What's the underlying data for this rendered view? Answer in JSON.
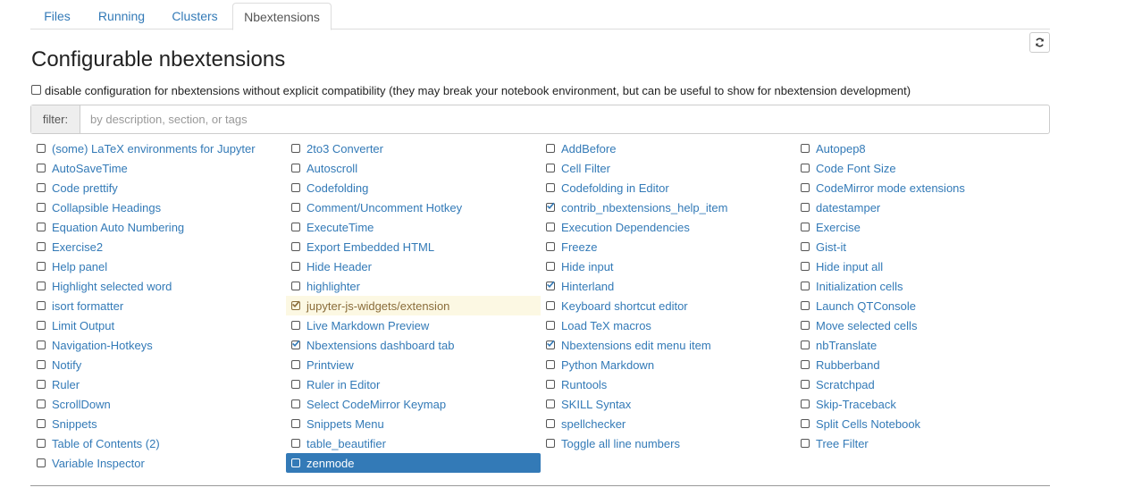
{
  "tabs": [
    {
      "label": "Files",
      "active": false
    },
    {
      "label": "Running",
      "active": false
    },
    {
      "label": "Clusters",
      "active": false
    },
    {
      "label": "Nbextensions",
      "active": true
    }
  ],
  "page_title": "Configurable nbextensions",
  "compat": {
    "label": "disable configuration for nbextensions without explicit compatibility (they may break your notebook environment, but can be useful to show for nbextension development)",
    "checked": false
  },
  "filter": {
    "label": "filter:",
    "placeholder": "by description, section, or tags",
    "value": ""
  },
  "refresh_icon": "refresh-icon",
  "colors": {
    "link": "#337ab7",
    "highlight_bg": "#fcf8e3",
    "highlight_text": "#8a6d3b",
    "selected_bg": "#337ab7"
  },
  "extensions": [
    [
      {
        "label": "(some) LaTeX environments for Jupyter",
        "checked": false
      },
      {
        "label": "AutoSaveTime",
        "checked": false
      },
      {
        "label": "Code prettify",
        "checked": false
      },
      {
        "label": "Collapsible Headings",
        "checked": false
      },
      {
        "label": "Equation Auto Numbering",
        "checked": false
      },
      {
        "label": "Exercise2",
        "checked": false
      },
      {
        "label": "Help panel",
        "checked": false
      },
      {
        "label": "Highlight selected word",
        "checked": false
      },
      {
        "label": "isort formatter",
        "checked": false
      },
      {
        "label": "Limit Output",
        "checked": false
      },
      {
        "label": "Navigation-Hotkeys",
        "checked": false
      },
      {
        "label": "Notify",
        "checked": false
      },
      {
        "label": "Ruler",
        "checked": false
      },
      {
        "label": "ScrollDown",
        "checked": false
      },
      {
        "label": "Snippets",
        "checked": false
      },
      {
        "label": "Table of Contents (2)",
        "checked": false
      },
      {
        "label": "Variable Inspector",
        "checked": false
      }
    ],
    [
      {
        "label": "2to3 Converter",
        "checked": false
      },
      {
        "label": "Autoscroll",
        "checked": false
      },
      {
        "label": "Codefolding",
        "checked": false
      },
      {
        "label": "Comment/Uncomment Hotkey",
        "checked": false
      },
      {
        "label": "ExecuteTime",
        "checked": false
      },
      {
        "label": "Export Embedded HTML",
        "checked": false
      },
      {
        "label": "Hide Header",
        "checked": false
      },
      {
        "label": "highlighter",
        "checked": false
      },
      {
        "label": "jupyter-js-widgets/extension",
        "checked": true,
        "state": "highlighted"
      },
      {
        "label": "Live Markdown Preview",
        "checked": false
      },
      {
        "label": "Nbextensions dashboard tab",
        "checked": true
      },
      {
        "label": "Printview",
        "checked": false
      },
      {
        "label": "Ruler in Editor",
        "checked": false
      },
      {
        "label": "Select CodeMirror Keymap",
        "checked": false
      },
      {
        "label": "Snippets Menu",
        "checked": false
      },
      {
        "label": "table_beautifier",
        "checked": false
      },
      {
        "label": "zenmode",
        "checked": false,
        "state": "selected"
      }
    ],
    [
      {
        "label": "AddBefore",
        "checked": false
      },
      {
        "label": "Cell Filter",
        "checked": false
      },
      {
        "label": "Codefolding in Editor",
        "checked": false
      },
      {
        "label": "contrib_nbextensions_help_item",
        "checked": true
      },
      {
        "label": "Execution Dependencies",
        "checked": false
      },
      {
        "label": "Freeze",
        "checked": false
      },
      {
        "label": "Hide input",
        "checked": false
      },
      {
        "label": "Hinterland",
        "checked": true
      },
      {
        "label": "Keyboard shortcut editor",
        "checked": false
      },
      {
        "label": "Load TeX macros",
        "checked": false
      },
      {
        "label": "Nbextensions edit menu item",
        "checked": true
      },
      {
        "label": "Python Markdown",
        "checked": false
      },
      {
        "label": "Runtools",
        "checked": false
      },
      {
        "label": "SKILL Syntax",
        "checked": false
      },
      {
        "label": "spellchecker",
        "checked": false
      },
      {
        "label": "Toggle all line numbers",
        "checked": false
      }
    ],
    [
      {
        "label": "Autopep8",
        "checked": false
      },
      {
        "label": "Code Font Size",
        "checked": false
      },
      {
        "label": "CodeMirror mode extensions",
        "checked": false
      },
      {
        "label": "datestamper",
        "checked": false
      },
      {
        "label": "Exercise",
        "checked": false
      },
      {
        "label": "Gist-it",
        "checked": false
      },
      {
        "label": "Hide input all",
        "checked": false
      },
      {
        "label": "Initialization cells",
        "checked": false
      },
      {
        "label": "Launch QTConsole",
        "checked": false
      },
      {
        "label": "Move selected cells",
        "checked": false
      },
      {
        "label": "nbTranslate",
        "checked": false
      },
      {
        "label": "Rubberband",
        "checked": false
      },
      {
        "label": "Scratchpad",
        "checked": false
      },
      {
        "label": "Skip-Traceback",
        "checked": false
      },
      {
        "label": "Split Cells Notebook",
        "checked": false
      },
      {
        "label": "Tree Filter",
        "checked": false
      }
    ]
  ]
}
